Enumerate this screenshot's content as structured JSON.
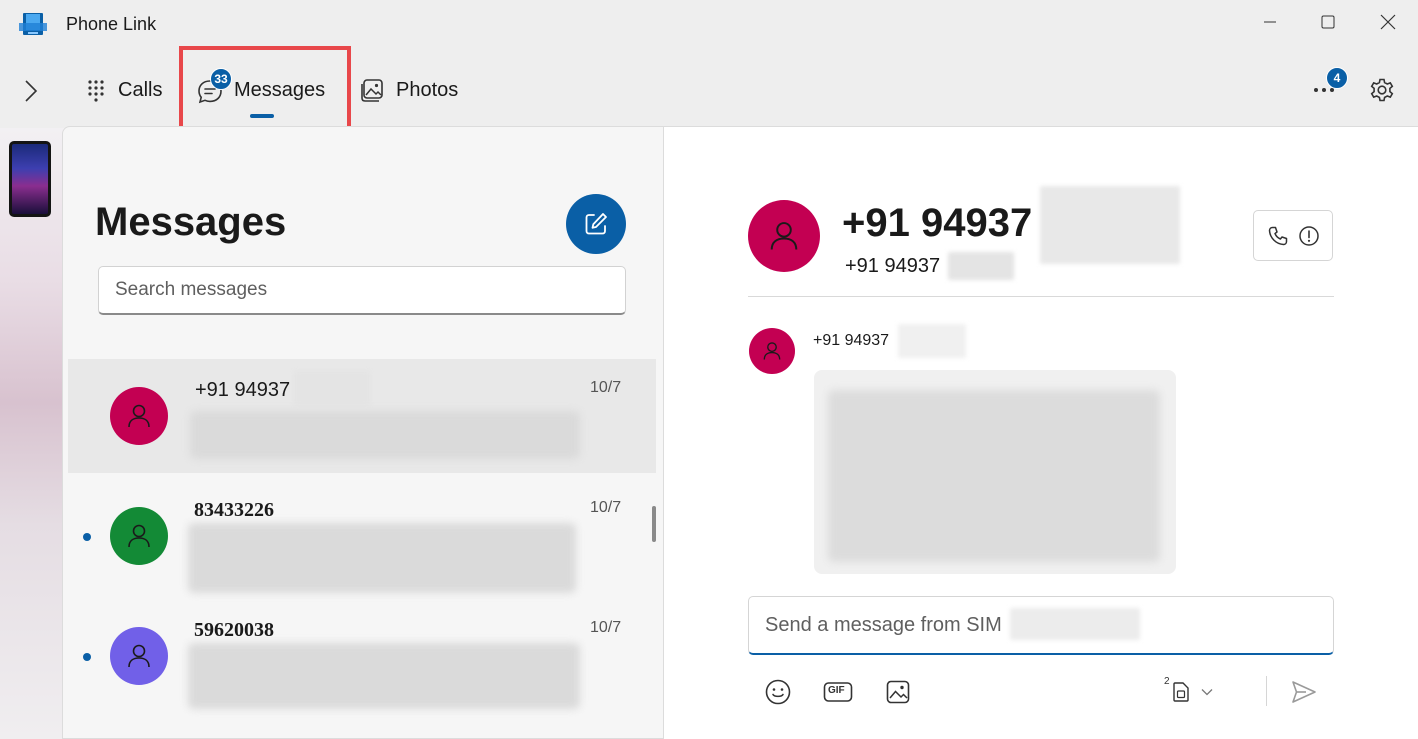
{
  "window": {
    "title": "Phone Link"
  },
  "nav": {
    "tabs": [
      {
        "label": "Calls",
        "icon": "dialpad-icon"
      },
      {
        "label": "Messages",
        "icon": "chat-bubble-icon",
        "badge": "33",
        "active": true
      },
      {
        "label": "Photos",
        "icon": "photo-icon"
      }
    ],
    "more_badge": "4"
  },
  "messages_list": {
    "title": "Messages",
    "search_placeholder": "Search messages",
    "conversations": [
      {
        "name": "+91 94937",
        "date": "10/7",
        "avatar_color": "#c30052",
        "unread": false,
        "selected": true
      },
      {
        "name": "83433226",
        "date": "10/7",
        "avatar_color": "#138a36",
        "unread": true,
        "selected": false
      },
      {
        "name": "59620038",
        "date": "10/7",
        "avatar_color": "#7160e8",
        "unread": true,
        "selected": false
      }
    ]
  },
  "conversation": {
    "header_name": "+91 94937",
    "header_sub": "+91 94937",
    "sender": "+91 94937",
    "compose_placeholder": "Send a message from SIM",
    "sim_number": "2",
    "gif_label": "GIF"
  },
  "colors": {
    "accent": "#0a5fa6",
    "highlight": "#e8474a"
  }
}
